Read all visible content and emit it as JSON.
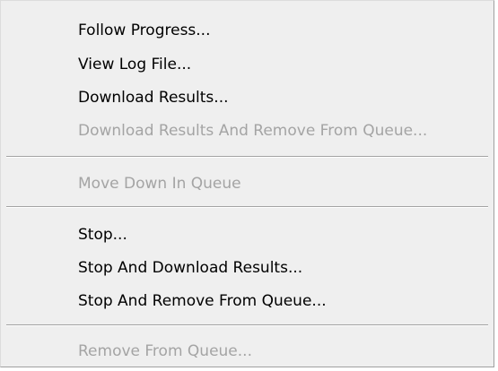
{
  "menu": {
    "items": [
      {
        "label": "Follow Progress...",
        "enabled": true
      },
      {
        "label": "View Log File...",
        "enabled": true
      },
      {
        "label": "Download Results...",
        "enabled": true
      },
      {
        "label": "Download Results And Remove From Queue...",
        "enabled": false
      },
      {
        "label": "Move Down In Queue",
        "enabled": false
      },
      {
        "label": "Stop...",
        "enabled": true
      },
      {
        "label": "Stop And Download Results...",
        "enabled": true
      },
      {
        "label": "Stop And Remove From Queue...",
        "enabled": true
      },
      {
        "label": "Remove From Queue...",
        "enabled": false
      }
    ]
  }
}
